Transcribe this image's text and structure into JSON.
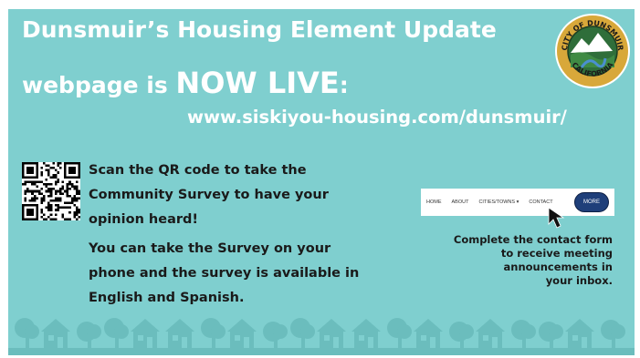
{
  "title": {
    "line1": "Dunsmuir’s Housing Element Update",
    "line2_prefix": "webpage is ",
    "line2_emph": "NOW LIVE",
    "line2_suffix": ":"
  },
  "url": "www.siskiyou-housing.com/dunsmuir/",
  "seal": {
    "top_text": "CITY OF DUNSMUIR",
    "bottom_text": "CALIFORNIA"
  },
  "qr_text": [
    "Scan the QR code to take the",
    "Community Survey to have your",
    "opinion heard!"
  ],
  "survey_text": [
    "You can take the Survey on your",
    "phone and the survey is available in",
    "English and Spanish."
  ],
  "nav": {
    "items": [
      "HOME",
      "ABOUT",
      "CITIES/TOWNS ▾",
      "CONTACT"
    ],
    "more": "MORE"
  },
  "contact_text": [
    "Complete the contact form",
    "to receive meeting",
    "announcements in",
    "your inbox."
  ],
  "colors": {
    "background": "#7fcfcf",
    "skyline": "#6bbdbd",
    "text_dark": "#1a1a1a",
    "more_button": "#1f3f7a"
  }
}
